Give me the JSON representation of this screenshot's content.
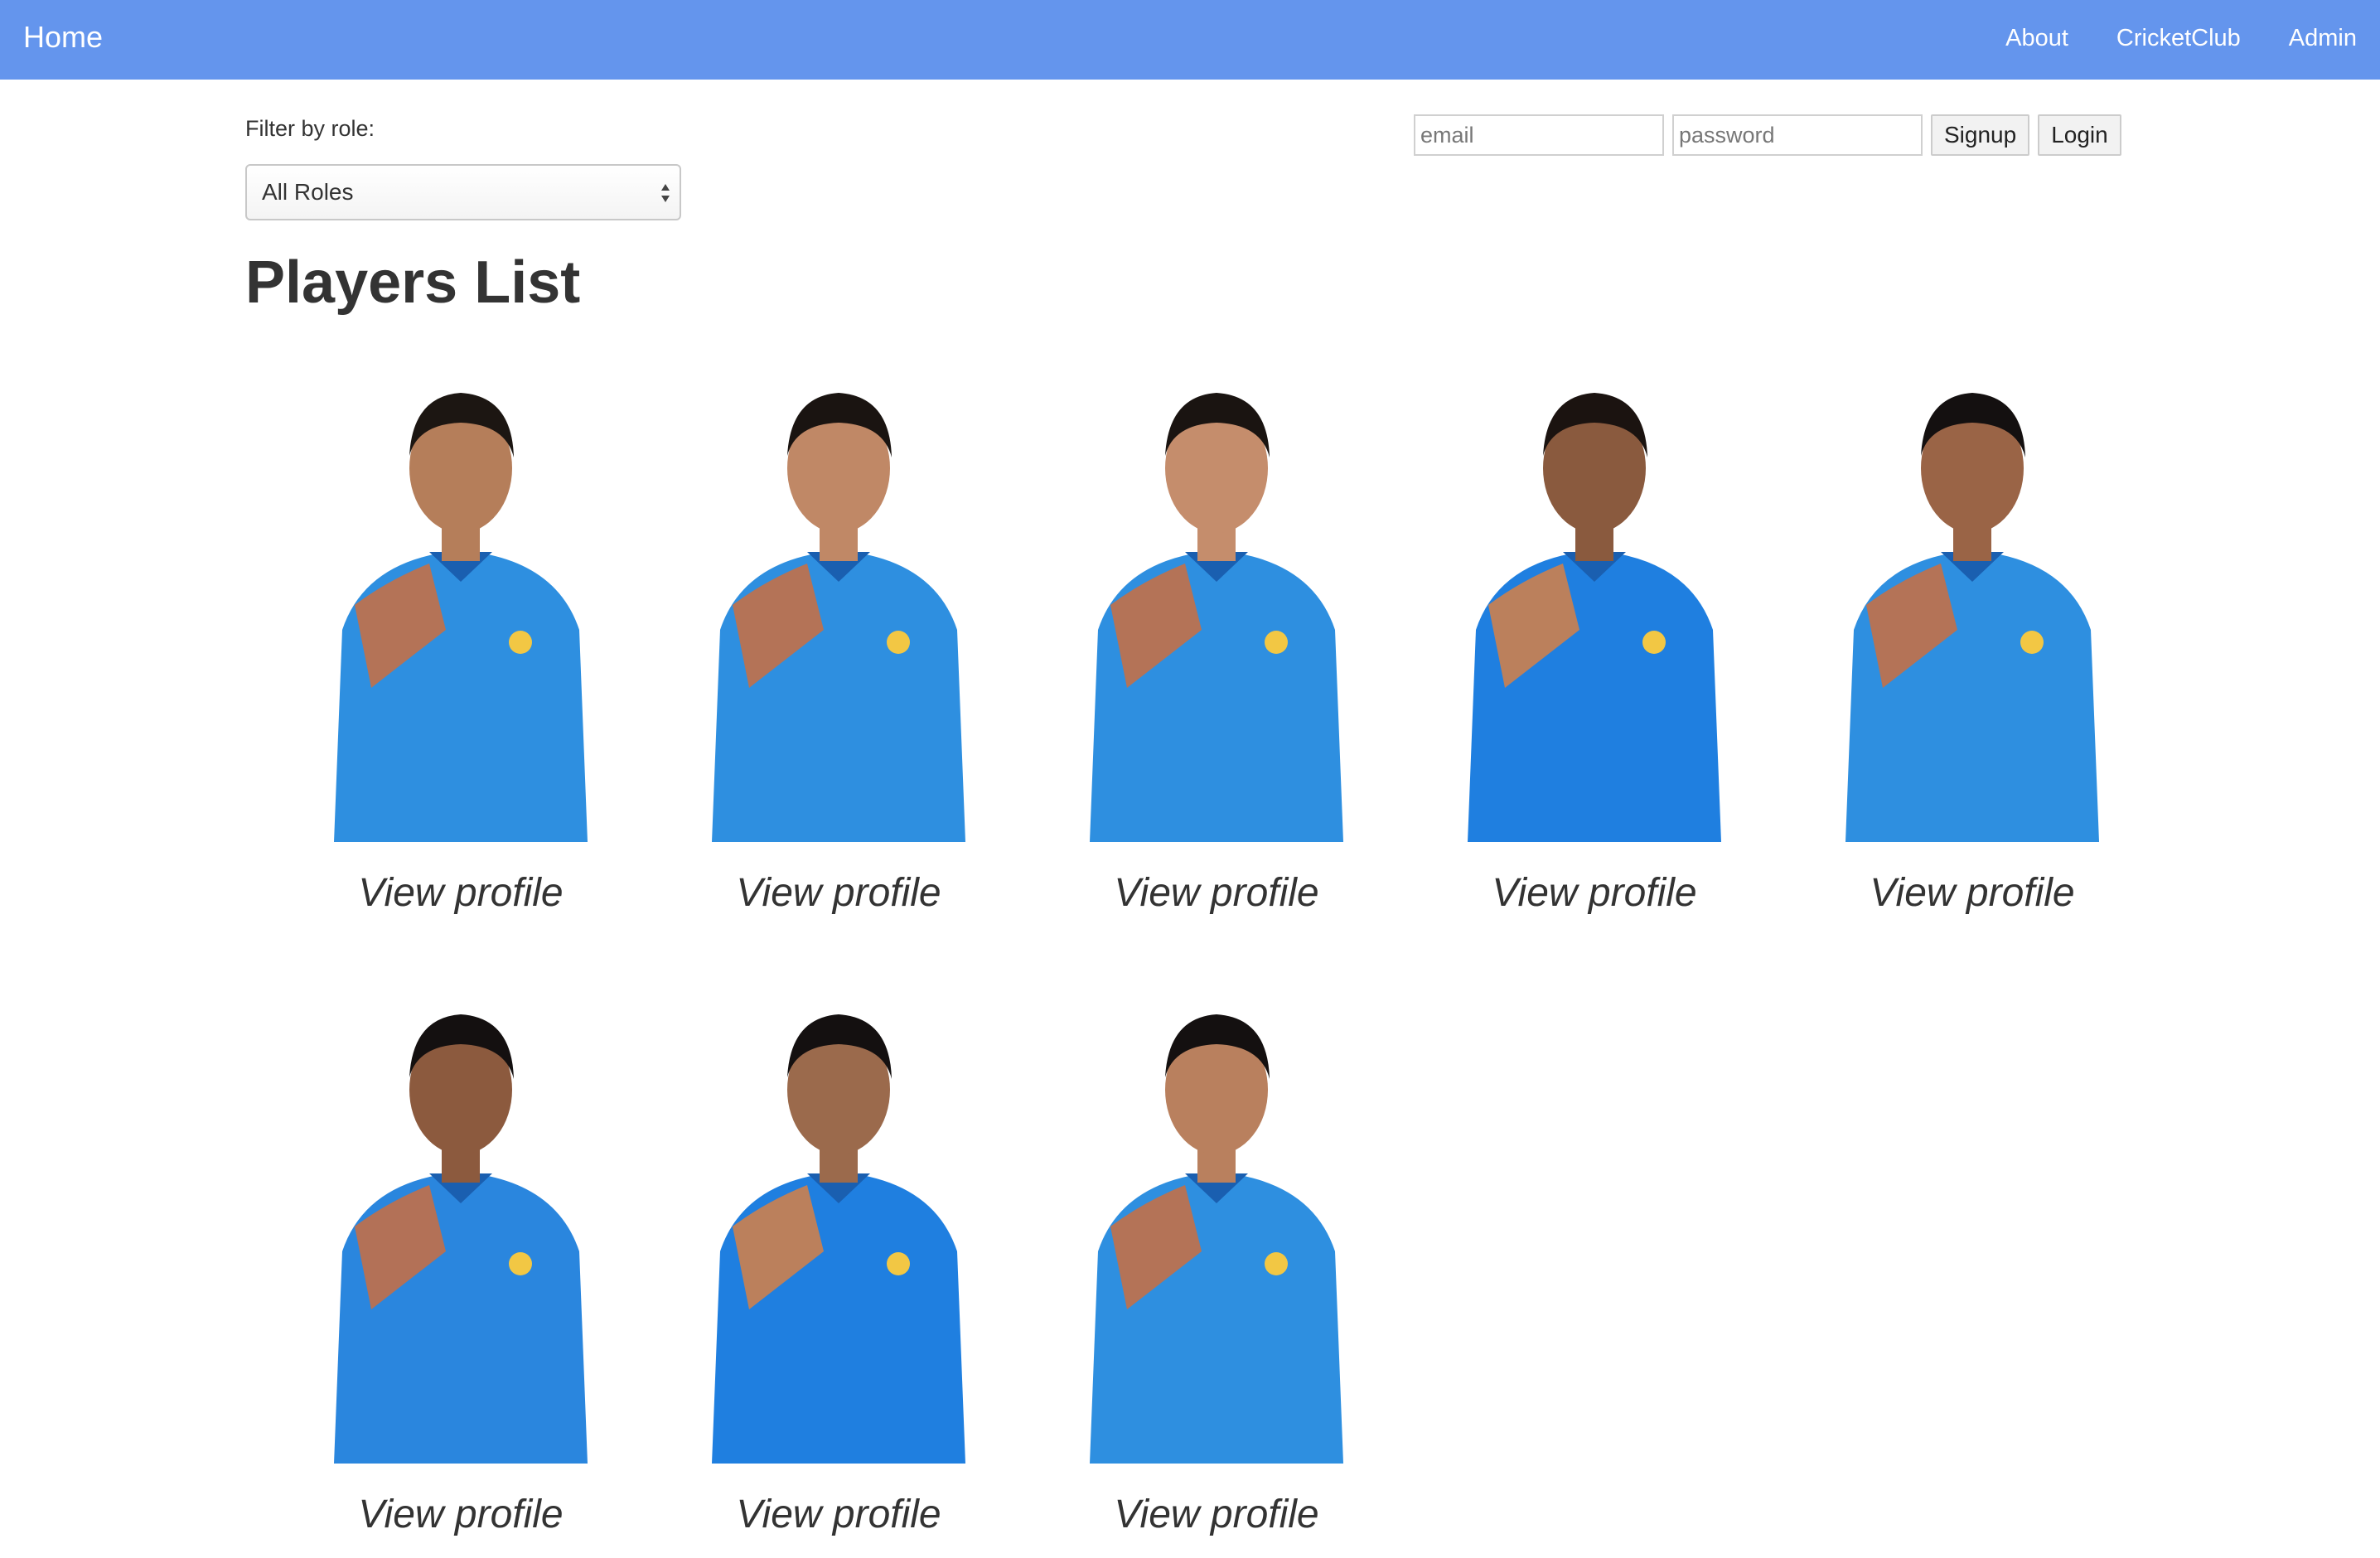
{
  "navbar": {
    "home_label": "Home",
    "links": [
      "About",
      "CricketClub",
      "Admin"
    ],
    "background": "#6495ed"
  },
  "filter": {
    "label": "Filter by role:",
    "selected": "All Roles"
  },
  "auth": {
    "email_placeholder": "email",
    "password_placeholder": "password",
    "signup_label": "Signup",
    "login_label": "Login"
  },
  "page": {
    "title": "Players List"
  },
  "players": [
    {
      "link_label": "View profile",
      "skin": "#b57e5a",
      "hair": "#1c1612",
      "shirt": "#2e8fe0",
      "accent": "#e2692a"
    },
    {
      "link_label": "View profile",
      "skin": "#c08866",
      "hair": "#1a1411",
      "shirt": "#2e8fe0",
      "accent": "#e2692a"
    },
    {
      "link_label": "View profile",
      "skin": "#c58d6c",
      "hair": "#1a1411",
      "shirt": "#2e8fe0",
      "accent": "#e2692a"
    },
    {
      "link_label": "View profile",
      "skin": "#8a5a3e",
      "hair": "#1b1310",
      "shirt": "#1f7fe0",
      "accent": "#f08030"
    },
    {
      "link_label": "View profile",
      "skin": "#9a6446",
      "hair": "#141010",
      "shirt": "#2e8fe0",
      "accent": "#e2692a"
    },
    {
      "link_label": "View profile",
      "skin": "#8c5a3e",
      "hair": "#141010",
      "shirt": "#2a86de",
      "accent": "#e2692a"
    },
    {
      "link_label": "View profile",
      "skin": "#9b6a4c",
      "hair": "#141010",
      "shirt": "#1f7fe0",
      "accent": "#f08030"
    },
    {
      "link_label": "View profile",
      "skin": "#b9805e",
      "hair": "#141010",
      "shirt": "#2e8fe0",
      "accent": "#e2692a"
    }
  ]
}
